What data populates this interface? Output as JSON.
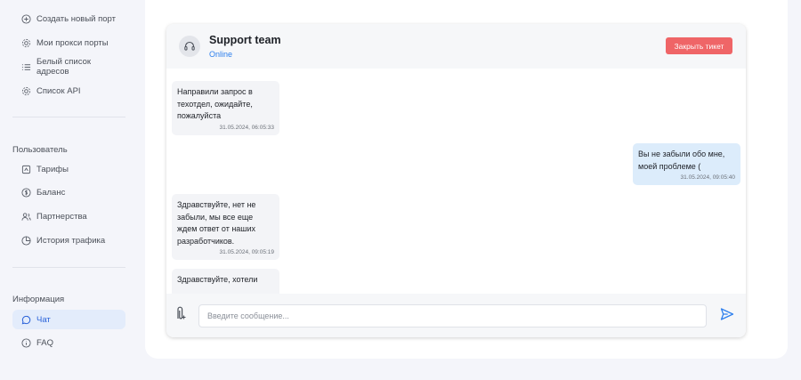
{
  "sidebar": {
    "items": [
      {
        "label": "Создать новый порт",
        "icon": "plus-circle-icon"
      },
      {
        "label": "Мои прокси порты",
        "icon": "gear-icon"
      },
      {
        "label": "Белый список адресов",
        "icon": "list-icon"
      },
      {
        "label": "Список API",
        "icon": "gear-icon"
      }
    ],
    "user_section": {
      "title": "Пользователь",
      "items": [
        {
          "label": "Тарифы",
          "icon": "tariff-icon"
        },
        {
          "label": "Баланс",
          "icon": "dollar-icon"
        },
        {
          "label": "Партнерства",
          "icon": "partners-icon"
        },
        {
          "label": "История трафика",
          "icon": "chart-icon"
        }
      ]
    },
    "info_section": {
      "title": "Информация",
      "items": [
        {
          "label": "Чат",
          "icon": "chat-icon",
          "active": true
        },
        {
          "label": "FAQ",
          "icon": "info-icon"
        }
      ]
    }
  },
  "chat": {
    "agent_name": "Support team",
    "agent_status": "Online",
    "close_button": "Закрыть тикет",
    "messages": [
      {
        "direction": "in",
        "text": "Направили запрос в техотдел, ожидайте, пожалуйста",
        "time": "31.05.2024, 06:05:33"
      },
      {
        "direction": "out",
        "text": "Вы не забыли обо мне, моей проблеме (",
        "time": "31.05.2024, 09:05:40"
      },
      {
        "direction": "in",
        "text": "Здравствуйте, нет не забыли, мы все еще ждем ответ от наших разработчиков.",
        "time": "31.05.2024, 09:05:19"
      },
      {
        "direction": "in",
        "text": "Здравствуйте, хотели",
        "time": ""
      }
    ],
    "input_placeholder": "Введите сообщение...",
    "input_value": ""
  },
  "colors": {
    "accent": "#2f80ed",
    "danger": "#ef6567",
    "outgoing_bubble": "#dcecfb",
    "incoming_bubble": "#f3f4f7",
    "active_nav": "#e3ecfb"
  }
}
